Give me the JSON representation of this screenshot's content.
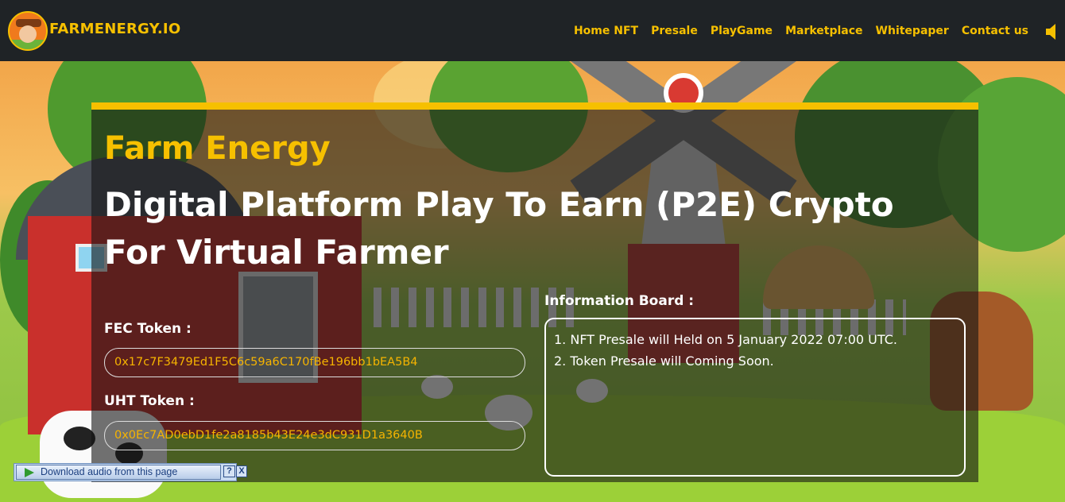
{
  "nav": {
    "brand": "FARMENERGY.IO",
    "items": [
      {
        "label": "Home NFT"
      },
      {
        "label": "Presale"
      },
      {
        "label": "PlayGame"
      },
      {
        "label": "Marketplace"
      },
      {
        "label": "Whitepaper"
      },
      {
        "label": "Contact us"
      }
    ],
    "sound_icon": "speaker-icon"
  },
  "hero": {
    "kicker": "Farm Energy",
    "headline": "Digital Platform Play To Earn (P2E) Crypto For Virtual Farmer"
  },
  "tokens": {
    "fec_label": "FEC Token :",
    "fec_address": "0x17c7F3479Ed1F5C6c59a6C170fBe196bb1bEA5B4",
    "uht_label": "UHT Token :",
    "uht_address": "0x0Ec7AD0ebD1fe2a8185b43E24e3dC931D1a3640B"
  },
  "info": {
    "title": "Information Board :",
    "items": [
      "1. NFT Presale will Held on 5 January 2022 07:00 UTC.",
      "2. Token Presale will Coming Soon."
    ]
  },
  "audio_bar": {
    "download_label": "Download audio from this page",
    "help_label": "?",
    "close_label": "X"
  },
  "colors": {
    "accent": "#f6c000",
    "nav_bg": "#1f2326",
    "address_text": "#f6b400"
  }
}
